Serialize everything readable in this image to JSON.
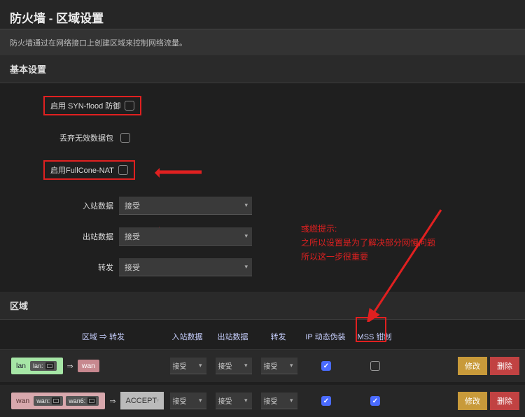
{
  "header": {
    "title": "防火墙 - 区域设置"
  },
  "description": "防火墙通过在网络接口上创建区域来控制网络流量。",
  "sections": {
    "basic": "基本设置",
    "zones": "区域"
  },
  "form": {
    "syn_flood": {
      "label": "启用 SYN-flood 防御"
    },
    "drop_invalid": {
      "label": "丢弃无效数据包"
    },
    "fullcone": {
      "label": "启用FullCone-NAT"
    },
    "input": {
      "label": "入站数据",
      "value": "接受"
    },
    "output": {
      "label": "出站数据",
      "value": "接受"
    },
    "forward": {
      "label": "转发",
      "value": "接受"
    }
  },
  "annotation": {
    "l1": "彧繎提示:",
    "l2": "之所以设置是为了解决部分网慢问题",
    "l3": "所以这一步很重要"
  },
  "zonetable": {
    "headers": {
      "zone": "区域 ⇒ 转发",
      "in": "入站数据",
      "out": "出站数据",
      "fw": "转发",
      "ip": "IP 动态伪装",
      "mss": "MSS 钳制"
    },
    "rows": [
      {
        "zone": "lan",
        "ifaces": [
          "lan:"
        ],
        "dest": "wan",
        "in": "接受",
        "out": "接受",
        "fw": "接受",
        "nat": true,
        "mss": false
      },
      {
        "zone": "wan",
        "ifaces": [
          "wan:",
          "wan6:"
        ],
        "dest": "ACCEPT",
        "in": "接受",
        "out": "接受",
        "fw": "接受",
        "nat": true,
        "mss": true
      }
    ],
    "buttons": {
      "edit": "修改",
      "delete": "删除"
    }
  }
}
